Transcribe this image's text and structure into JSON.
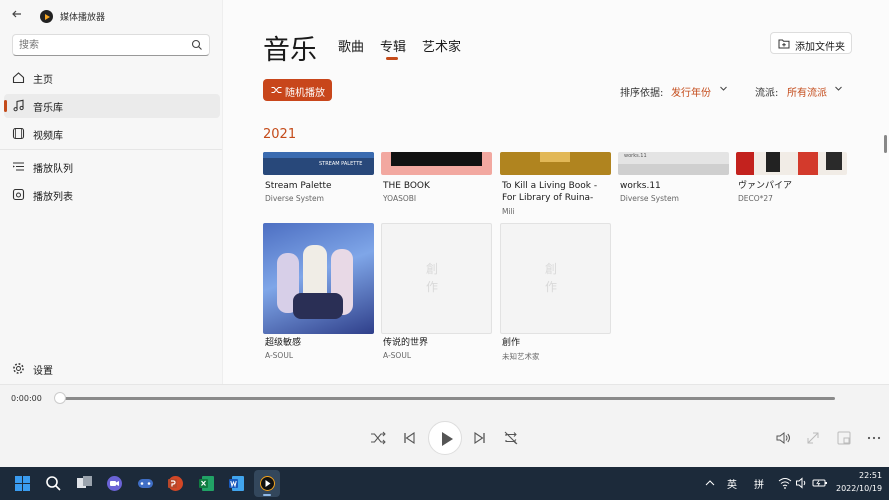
{
  "window": {
    "title": "媒体播放器"
  },
  "sidebar": {
    "search_placeholder": "搜索",
    "items": [
      {
        "label": "主页",
        "icon": "home-icon"
      },
      {
        "label": "音乐库",
        "icon": "music-note-icon",
        "active": true
      },
      {
        "label": "视频库",
        "icon": "video-icon"
      },
      {
        "label": "播放队列",
        "icon": "queue-icon"
      },
      {
        "label": "播放列表",
        "icon": "playlist-icon"
      }
    ],
    "settings_label": "设置"
  },
  "main": {
    "title": "音乐",
    "tabs": [
      {
        "label": "歌曲"
      },
      {
        "label": "专辑",
        "active": true
      },
      {
        "label": "艺术家"
      }
    ],
    "add_folder_label": "添加文件夹",
    "shuffle_label": "随机播放",
    "sort_label": "排序依据:",
    "sort_value": "发行年份",
    "genre_label": "流派:",
    "genre_value": "所有流派",
    "year": "2021",
    "albums_row1": [
      {
        "title": "Stream Palette",
        "artist": "Diverse System"
      },
      {
        "title": "THE BOOK",
        "artist": "YOASOBI"
      },
      {
        "title": "To Kill a Living Book - For Library of Ruina-",
        "artist": "Mili"
      },
      {
        "title": "works.11",
        "artist": "Diverse System"
      },
      {
        "title": "ヴァンパイア",
        "artist": "DECO*27"
      }
    ],
    "albums_row2": [
      {
        "title": "超级敏感",
        "artist": "A-SOUL"
      },
      {
        "title": "传说的世界",
        "artist": "A-SOUL"
      },
      {
        "title": "創作",
        "artist": "未知艺术家"
      }
    ],
    "cover_texts": {
      "stream_palette": "STREAM PALETTE",
      "works": "works.11",
      "placeholder_char1": "創",
      "placeholder_char2": "作"
    }
  },
  "player": {
    "time": "0:00:00",
    "progress": 0
  },
  "taskbar": {
    "ime1": "英",
    "ime2": "拼",
    "time": "22:51",
    "date": "2022/10/19"
  },
  "colors": {
    "accent": "#c44b1a",
    "taskbar": "#1c2a3a"
  }
}
